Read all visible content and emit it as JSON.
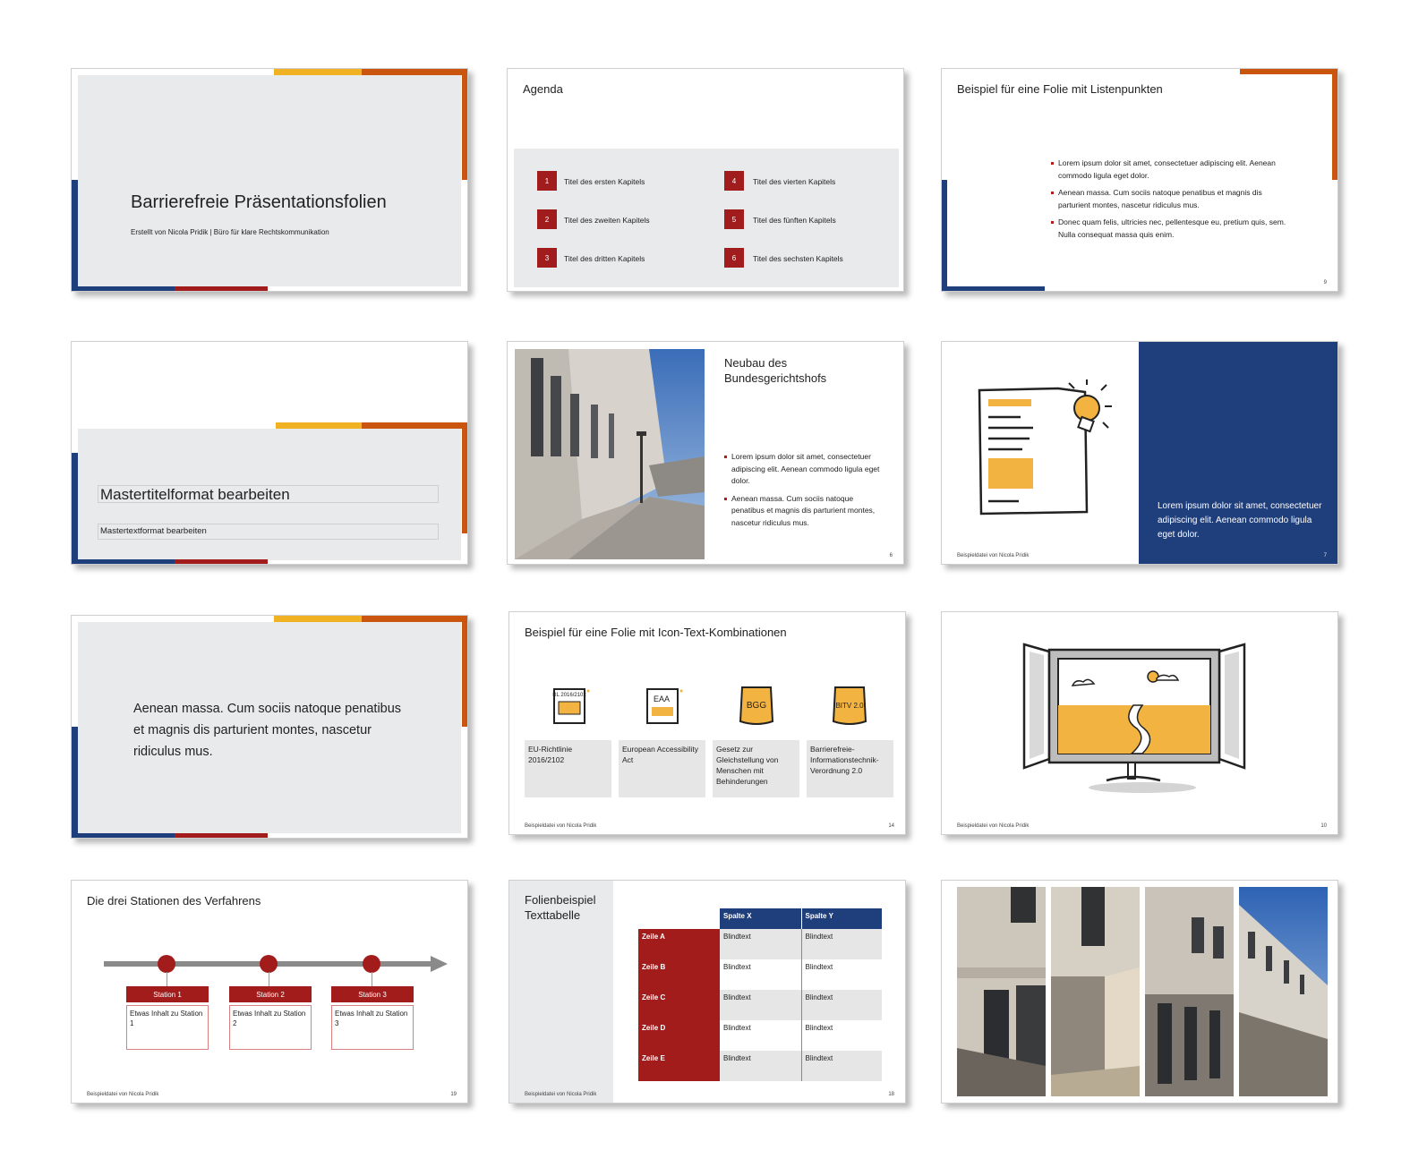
{
  "slide1": {
    "title": "Barrierefreie Präsentationsfolien",
    "subtitle": "Erstellt von Nicola Pridik  |  Büro für klare Rechtskommunikation"
  },
  "slide2": {
    "title": "Agenda",
    "items": [
      {
        "num": "1",
        "label": "Titel des ersten Kapitels"
      },
      {
        "num": "2",
        "label": "Titel des zweiten Kapitels"
      },
      {
        "num": "3",
        "label": "Titel des dritten Kapitels"
      },
      {
        "num": "4",
        "label": "Titel des vierten Kapitels"
      },
      {
        "num": "5",
        "label": "Titel des fünften Kapitels"
      },
      {
        "num": "6",
        "label": "Titel des sechsten Kapitels"
      }
    ]
  },
  "slide3": {
    "title": "Beispiel für eine Folie mit Listenpunkten",
    "bullets": [
      "Lorem ipsum dolor sit amet, consectetuer adipiscing elit. Aenean commodo ligula eget dolor.",
      "Aenean massa. Cum sociis natoque penatibus et magnis dis parturient montes, nascetur ridiculus mus.",
      "Donec quam felis, ultricies nec, pellentesque eu, pretium quis, sem. Nulla consequat massa quis enim."
    ],
    "page": "9"
  },
  "slide4": {
    "title": "Mastertitelformat bearbeiten",
    "text": "Mastertextformat bearbeiten"
  },
  "slide5": {
    "title": "Neubau des Bundesgerichtshofs",
    "bullets": [
      "Lorem ipsum dolor sit amet, consectetuer adipiscing elit. Aenean commodo ligula eget dolor.",
      "Aenean massa. Cum sociis natoque penatibus et magnis dis parturient montes, nascetur ridiculus mus."
    ],
    "page": "6"
  },
  "slide6": {
    "text": "Lorem ipsum dolor sit amet, consectetuer adipiscing elit. Aenean commodo ligula eget dolor.",
    "footer": "Beispieldatei von Nicola Pridik",
    "page": "7"
  },
  "slide7": {
    "quote": "Aenean massa. Cum sociis natoque penatibus et magnis dis parturient montes, nascetur ridiculus mus."
  },
  "slide8": {
    "title": "Beispiel für eine Folie mit Icon-Text-Kombinationen",
    "icons": [
      {
        "icon": "eu-directive-icon",
        "badge": "RL 2016/2102",
        "label": "EU-Richtlinie 2016/2102"
      },
      {
        "icon": "eaa-document-icon",
        "badge": "EAA",
        "label": "European Accessibility Act"
      },
      {
        "icon": "bgg-can-icon",
        "badge": "BGG",
        "label": "Gesetz zur Gleichstellung von Menschen mit Behinderungen"
      },
      {
        "icon": "bitv-can-icon",
        "badge": "BITV 2.0",
        "label": "Barrierefreie-Informationstechnik-Verordnung 2.0"
      }
    ],
    "footer": "Beispieldatei von Nicola Pridik",
    "page": "14"
  },
  "slide9": {
    "footer": "Beispieldatei von Nicola Pridik",
    "page": "10"
  },
  "slide10": {
    "title": "Die drei Stationen des Verfahrens",
    "stations": [
      {
        "head": "Station 1",
        "body": "Etwas Inhalt zu Station 1"
      },
      {
        "head": "Station 2",
        "body": "Etwas Inhalt zu Station 2"
      },
      {
        "head": "Station 3",
        "body": "Etwas Inhalt zu Station 3"
      }
    ],
    "footer": "Beispieldatei von Nicola Pridik",
    "page": "19"
  },
  "slide11": {
    "title": "Folienbeispiel Texttabelle",
    "columns": [
      "Spalte X",
      "Spalte Y"
    ],
    "rows": [
      {
        "label": "Zeile A",
        "x": "Blindtext",
        "y": "Blindtext"
      },
      {
        "label": "Zeile B",
        "x": "Blindtext",
        "y": "Blindtext"
      },
      {
        "label": "Zeile C",
        "x": "Blindtext",
        "y": "Blindtext"
      },
      {
        "label": "Zeile D",
        "x": "Blindtext",
        "y": "Blindtext"
      },
      {
        "label": "Zeile E",
        "x": "Blindtext",
        "y": "Blindtext"
      }
    ],
    "footer": "Beispieldatei von Nicola Pridik",
    "page": "18"
  },
  "colors": {
    "navy": "#1f3e7c",
    "red": "#a31c1c",
    "yellow": "#f0b223",
    "orange": "#c9550f",
    "gray": "#e9eaeb",
    "icon_yellow": "#f3b341"
  }
}
